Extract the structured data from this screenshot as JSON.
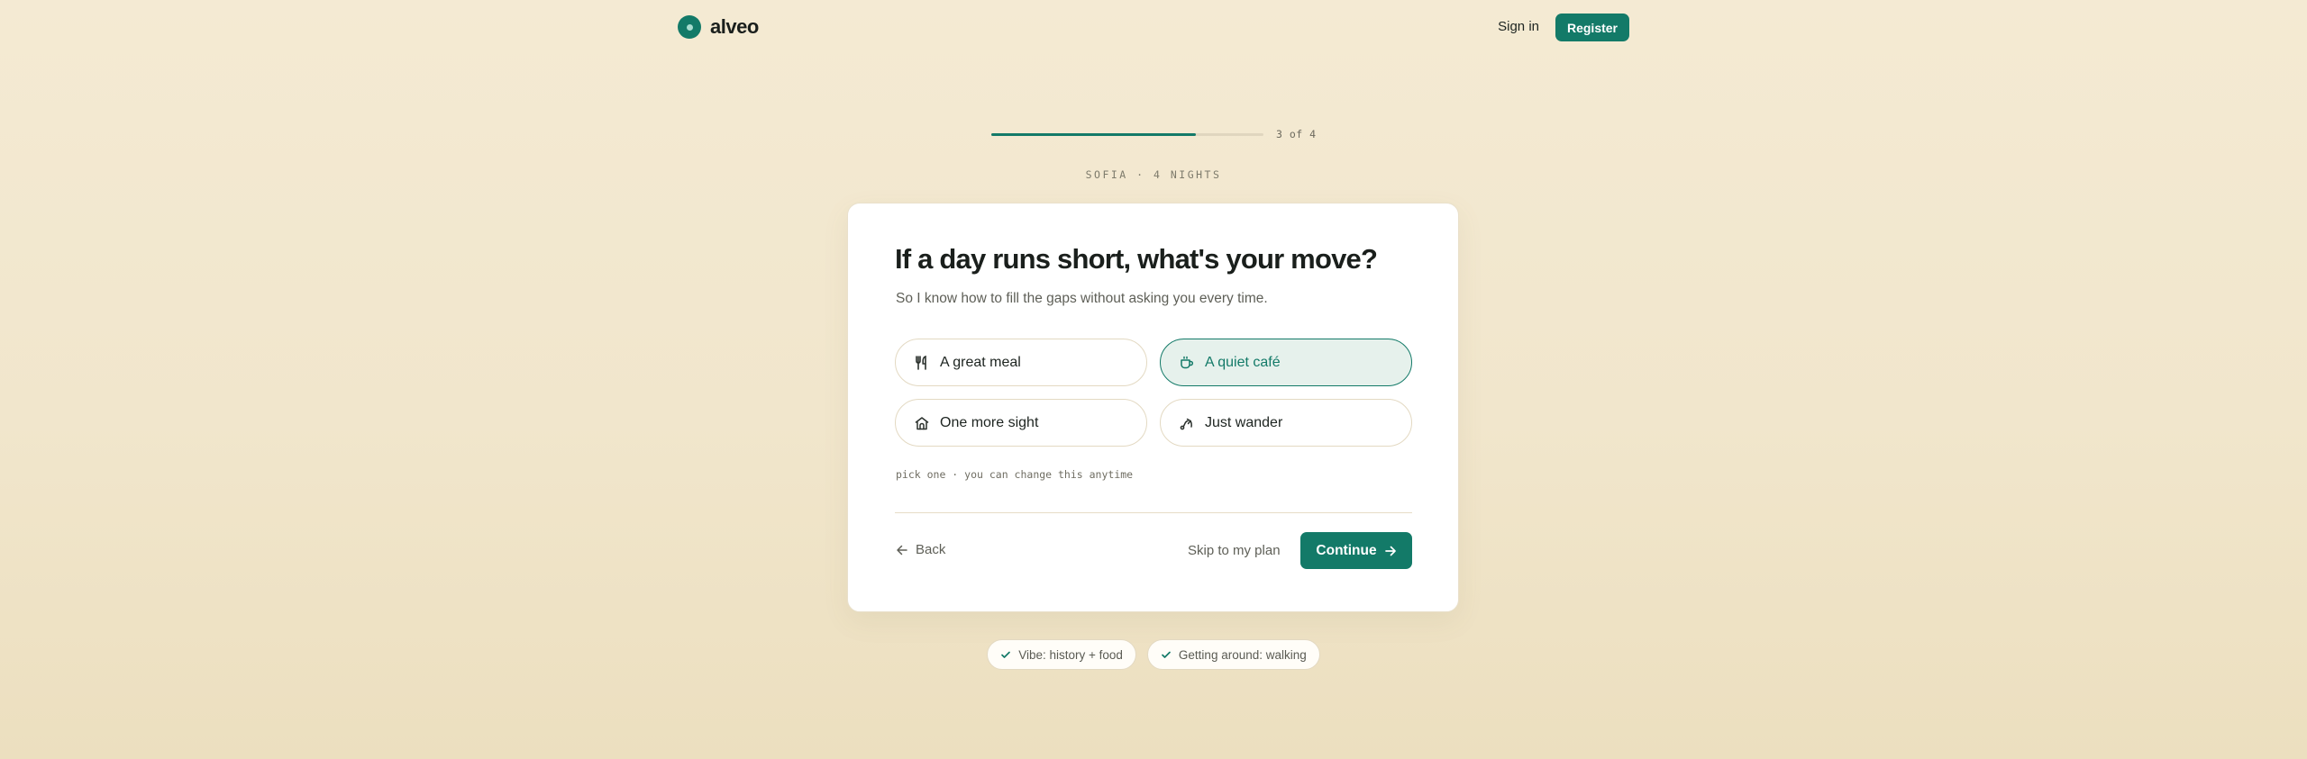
{
  "header": {
    "brand": "alveo",
    "signin_label": "Sign in",
    "register_label": "Register"
  },
  "progress": {
    "fraction": 0.75,
    "label": "3 of 4"
  },
  "trip_label": "SOFIA · 4 NIGHTS",
  "question": {
    "title": "If a day runs short, what's your move?",
    "subtitle": "So I know how to fill the gaps without asking you every time.",
    "options": [
      {
        "label": "A great meal",
        "icon": "fork-knife-icon",
        "selected": false
      },
      {
        "label": "A quiet café",
        "icon": "coffee-cup-icon",
        "selected": true
      },
      {
        "label": "One more sight",
        "icon": "landmark-icon",
        "selected": false
      },
      {
        "label": "Just wander",
        "icon": "route-icon",
        "selected": false
      }
    ],
    "hint": "pick one · you can change this anytime"
  },
  "actions": {
    "back_label": "Back",
    "skip_label": "Skip to my plan",
    "continue_label": "Continue"
  },
  "chips": [
    {
      "label": "Vibe: history + food",
      "icon": "check-icon"
    },
    {
      "label": "Getting around: walking",
      "icon": "check-icon"
    }
  ],
  "colors": {
    "accent": "#137a68",
    "selected_bg": "#e6f1ec",
    "page_bg": "#f3e9d2"
  }
}
